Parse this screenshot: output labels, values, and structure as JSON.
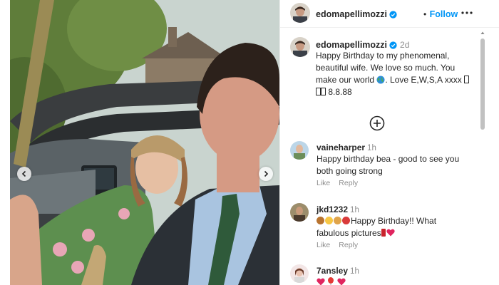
{
  "header": {
    "username": "edomapellimozzi",
    "dot": "•",
    "follow_label": "Follow",
    "more_icon": "more-horizontal-icon"
  },
  "caption": {
    "username": "edomapellimozzi",
    "time": "2d",
    "text_before_globe": "Happy Birthday to my phenomenal, beautiful wife. We love so much. You make our world",
    "text_after_globe": ". Love E,W,S,A xxxx",
    "text_end": "8.8.88"
  },
  "comments": [
    {
      "username": "vaineharper",
      "time": "1h",
      "text": "Happy birthday bea - good to see you both going strong",
      "like_label": "Like",
      "reply_label": "Reply"
    },
    {
      "username": "jkd1232",
      "time": "1h",
      "text_main": "Happy Birthday!! What fabulous pictures",
      "like_label": "Like",
      "reply_label": "Reply"
    },
    {
      "username": "7ansley",
      "time": "1h"
    }
  ],
  "colors": {
    "accent": "#0095f6",
    "verified": "#0095f6",
    "muted": "#8e8e8e",
    "text": "#262626"
  }
}
